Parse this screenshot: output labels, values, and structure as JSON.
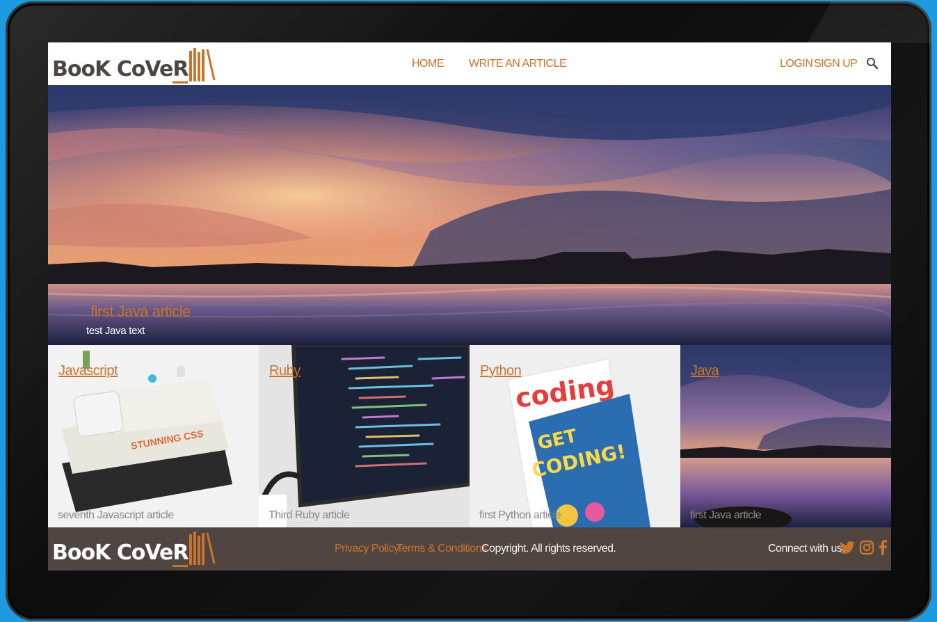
{
  "brand": {
    "logo_text_main": "BooK CoVe",
    "logo_text_r": "R",
    "accent": "#c8742c",
    "footer_bg": "#504540"
  },
  "header": {
    "nav": {
      "home": "HOME",
      "write": "WRITE AN ARTICLE"
    },
    "auth": {
      "login": "LOGIN",
      "signup": "SIGN UP"
    },
    "search_icon": "search-icon"
  },
  "hero": {
    "title": "first Java article",
    "subtitle": "test Java text"
  },
  "cards": [
    {
      "category": "Javascript",
      "description": "seventh Javascript article"
    },
    {
      "category": "Ruby",
      "description": "Third Ruby article"
    },
    {
      "category": "Python",
      "description": "first Python article"
    },
    {
      "category": "Java",
      "description": "first Java article"
    }
  ],
  "footer": {
    "privacy": "Privacy Policy",
    "terms": "Terms & Conditions",
    "copyright": "Copyright. All rights reserved.",
    "connect": "Connect with us:",
    "social_icons": [
      "twitter-icon",
      "instagram-icon",
      "facebook-icon"
    ]
  }
}
